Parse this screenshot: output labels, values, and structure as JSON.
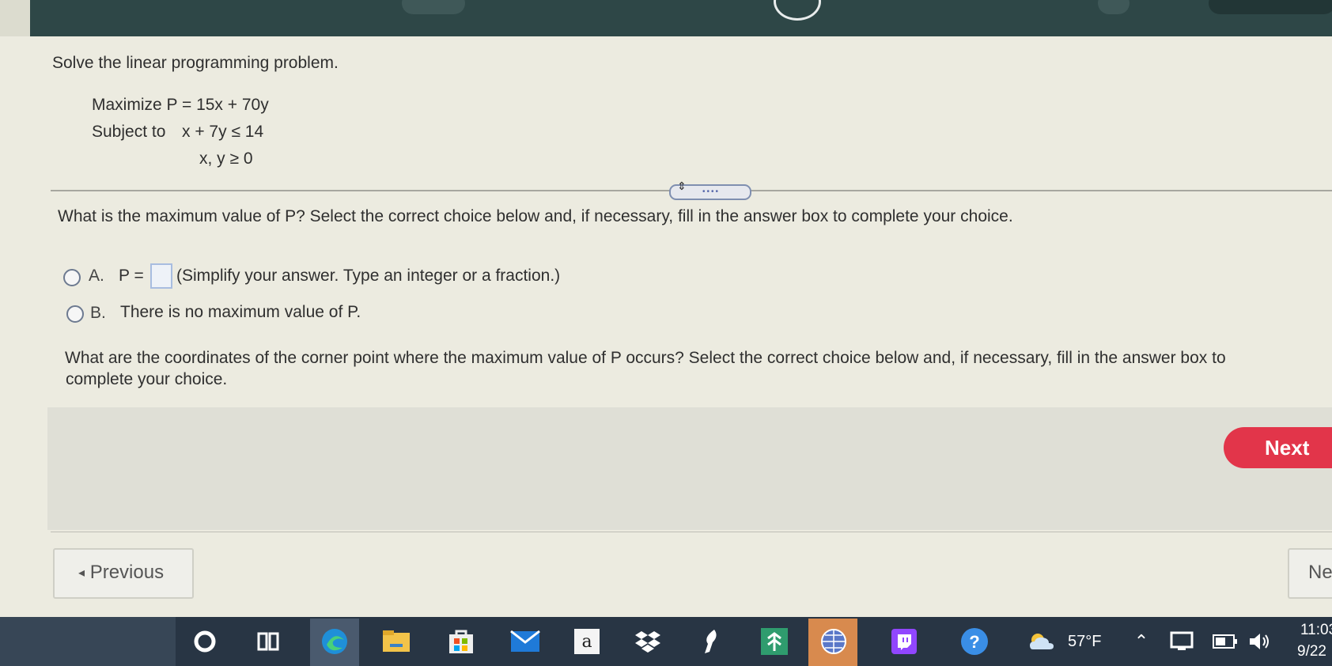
{
  "problem": {
    "instruction": "Solve the linear programming problem.",
    "objective": "Maximize P = 15x + 70y",
    "subject_label": "Subject to",
    "constraint1": "x + 7y ≤ 14",
    "constraint2": "x, y ≥ 0"
  },
  "question1": {
    "prompt": "What is the maximum value of P? Select the correct choice below and, if necessary, fill in the answer box to complete your choice.",
    "choice_a_letter": "A.",
    "choice_a_prefix": "P =",
    "choice_a_value": "",
    "choice_a_hint": "(Simplify your answer. Type an integer or a fraction.)",
    "choice_b_letter": "B.",
    "choice_b_text": "There is no maximum value of P."
  },
  "question2": {
    "line1": "What are the coordinates of the corner point where the maximum value of P occurs? Select the correct choice below and, if necessary, fill in the answer box to",
    "line2": "complete your choice."
  },
  "nav": {
    "next_label": "Next",
    "previous_label": "Previous",
    "next_bottom_label": "Ne"
  },
  "taskbar": {
    "weather": "57°F",
    "time": "11:03",
    "date": "9/22",
    "icons": [
      "cortana-icon",
      "task-view-icon",
      "edge-icon",
      "file-explorer-icon",
      "store-icon",
      "mail-icon",
      "amazon-icon",
      "dropbox-icon",
      "robinhood-icon",
      "green-app-icon",
      "web-app-icon",
      "twitch-icon",
      "help-icon",
      "weather-icon",
      "chevron-up-icon",
      "display-icon",
      "battery-icon",
      "volume-icon"
    ]
  },
  "colors": {
    "header": "#2e4747",
    "next_button": "#e2354a",
    "page_bg": "#ecebe0",
    "taskbar": "#283544"
  }
}
